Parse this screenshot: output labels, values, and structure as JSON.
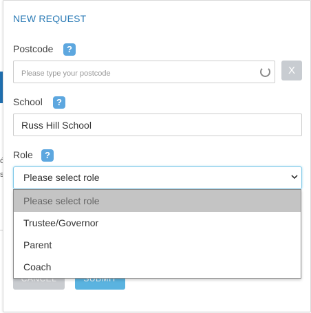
{
  "modal": {
    "title": "NEW REQUEST"
  },
  "postcode": {
    "label": "Postcode",
    "help": "?",
    "placeholder": "Please type your postcode",
    "clear_label": "X"
  },
  "school": {
    "label": "School",
    "help": "?",
    "value": "Russ Hill School"
  },
  "role": {
    "label": "Role",
    "help": "?",
    "selected": "Please select role",
    "options": [
      "Please select role",
      "Trustee/Governor",
      "Parent",
      "Coach"
    ]
  },
  "actions": {
    "cancel_label": "CANCEL",
    "submit_label": "SUBMIT"
  },
  "background": {
    "glyph_a": "ó",
    "glyph_b": "s"
  },
  "colors": {
    "accent": "#2a7ab5",
    "help_badge": "#5da7df",
    "submit": "#5ab3e0",
    "cancel": "#c9ccd0",
    "focus_border": "#7fc8e8",
    "option_highlight": "#c4c4c4"
  },
  "icons": {
    "help": "question-mark-icon",
    "loading": "spinner-icon",
    "dropdown": "chevron-down-icon"
  }
}
